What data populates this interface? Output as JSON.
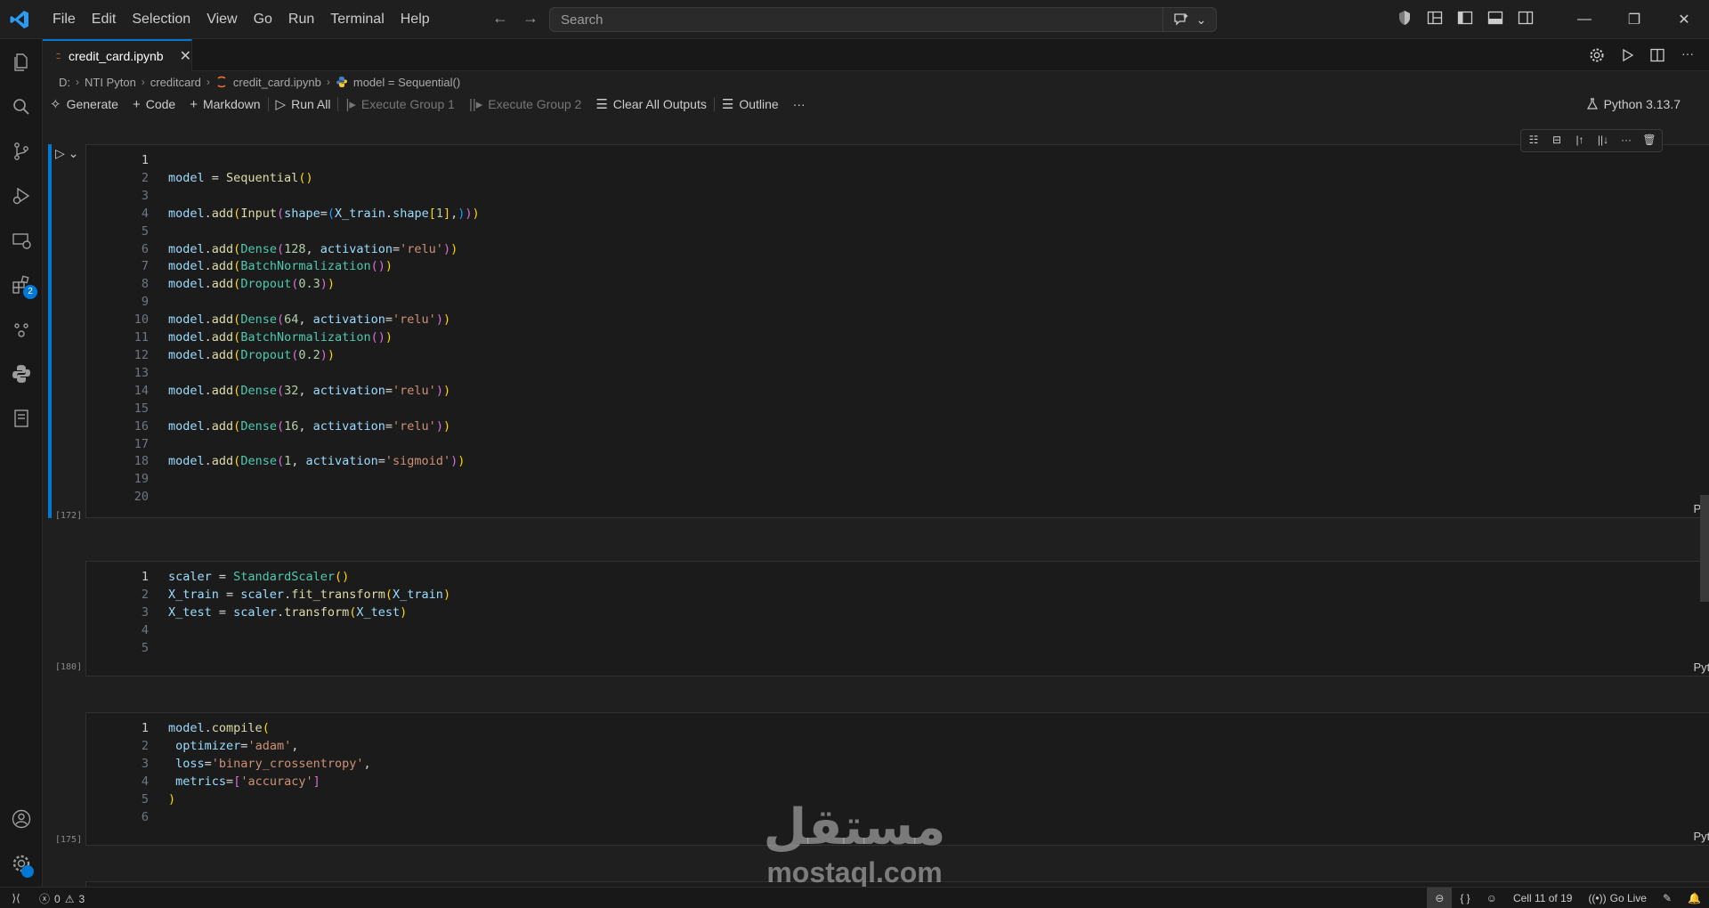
{
  "menu": [
    "File",
    "Edit",
    "Selection",
    "View",
    "Go",
    "Run",
    "Terminal",
    "Help"
  ],
  "search": {
    "placeholder": "Search"
  },
  "tab": {
    "label": "credit_card.ipynb",
    "close": "✕"
  },
  "breadcrumb": [
    "D:",
    "NTI Pyton",
    "creditcard",
    "credit_card.ipynb",
    "model = Sequential()"
  ],
  "toolbar": {
    "generate": "Generate",
    "code": "Code",
    "markdown": "Markdown",
    "run_all": "Run All",
    "execute_group_1": "Execute Group 1",
    "execute_group_2": "Execute Group 2",
    "clear_all_outputs": "Clear All Outputs",
    "outline": "Outline",
    "more": "···",
    "kernel": "Python 3.13.7"
  },
  "cells": [
    {
      "exec_count": "[172]",
      "lang": "Python",
      "line_count": 20
    },
    {
      "exec_count": "[180]",
      "lang": "Python",
      "line_count": 5
    },
    {
      "exec_count": "[175]",
      "lang": "Python",
      "line_count": 6
    }
  ],
  "watermark": {
    "arabic": "مستقل",
    "latin": "mostaql.com"
  },
  "status": {
    "errors": "0",
    "warnings": "3",
    "braces": "{ }",
    "cell_position": "Cell 11 of 19",
    "go_live": "Go Live"
  },
  "colors": {
    "accent": "#0078d4",
    "background": "#1f1f1f"
  }
}
